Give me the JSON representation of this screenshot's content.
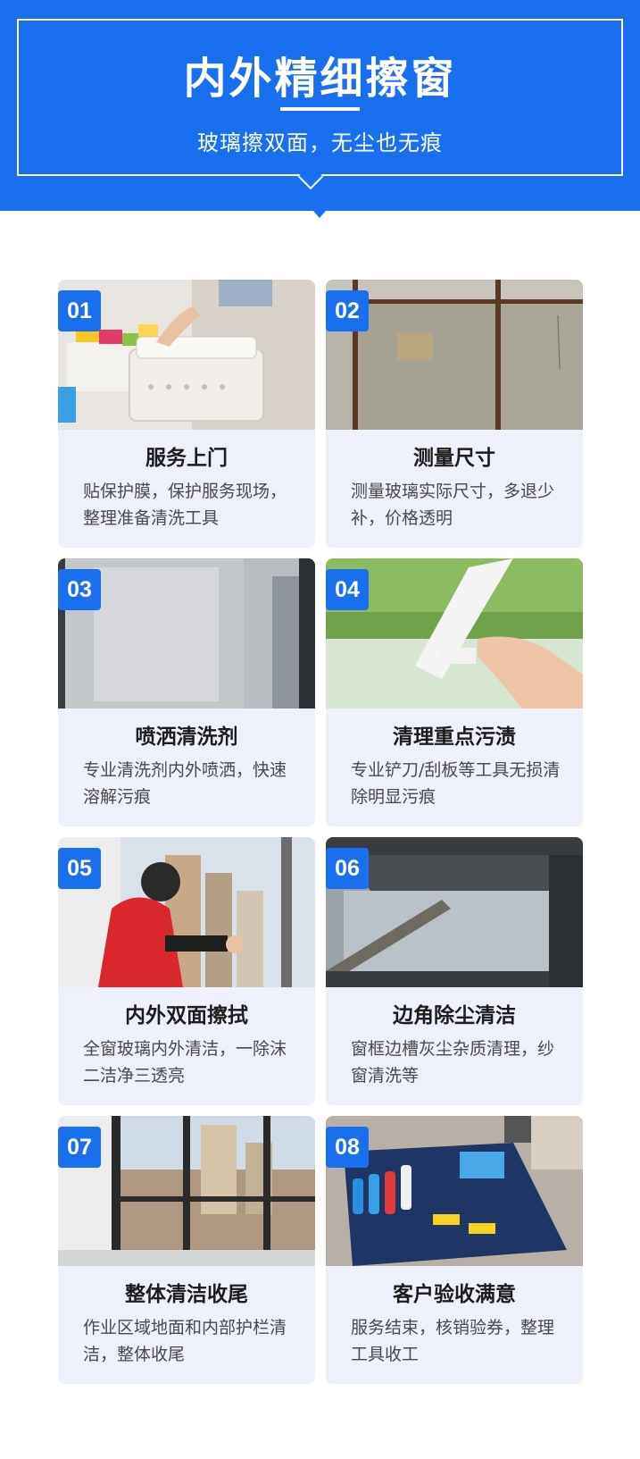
{
  "header": {
    "title": "内外精细擦窗",
    "subtitle": "玻璃擦双面，无尘也无痕"
  },
  "colors": {
    "accent": "#1a6ff0",
    "card_bg": "#eef0fb"
  },
  "steps": [
    {
      "number": "01",
      "title": "服务上门",
      "desc": "贴保护膜，保护服务现场，整理准备清洗工具",
      "photo": "photo-bucket-supplies"
    },
    {
      "number": "02",
      "title": "测量尺寸",
      "desc": "测量玻璃实际尺寸，多退少补，价格透明",
      "photo": "photo-dirty-window"
    },
    {
      "number": "03",
      "title": "喷洒清洗剂",
      "desc": "专业清洗剂内外喷洒，快速溶解污痕",
      "photo": "photo-foam-glass"
    },
    {
      "number": "04",
      "title": "清理重点污渍",
      "desc": "专业铲刀/刮板等工具无损清除明显污痕",
      "photo": "photo-squeegee-hand"
    },
    {
      "number": "05",
      "title": "内外双面擦拭",
      "desc": "全窗玻璃内外清洁，一除沫二洁净三透亮",
      "photo": "photo-worker-window"
    },
    {
      "number": "06",
      "title": "边角除尘清洁",
      "desc": "窗框边槽灰尘杂质清理，纱窗清洗等",
      "photo": "photo-window-frame"
    },
    {
      "number": "07",
      "title": "整体清洁收尾",
      "desc": "作业区域地面和内部护栏清洁，整体收尾",
      "photo": "photo-clean-view"
    },
    {
      "number": "08",
      "title": "客户验收满意",
      "desc": "服务结束，核销验券，整理工具收工",
      "photo": "photo-tool-kit"
    }
  ]
}
